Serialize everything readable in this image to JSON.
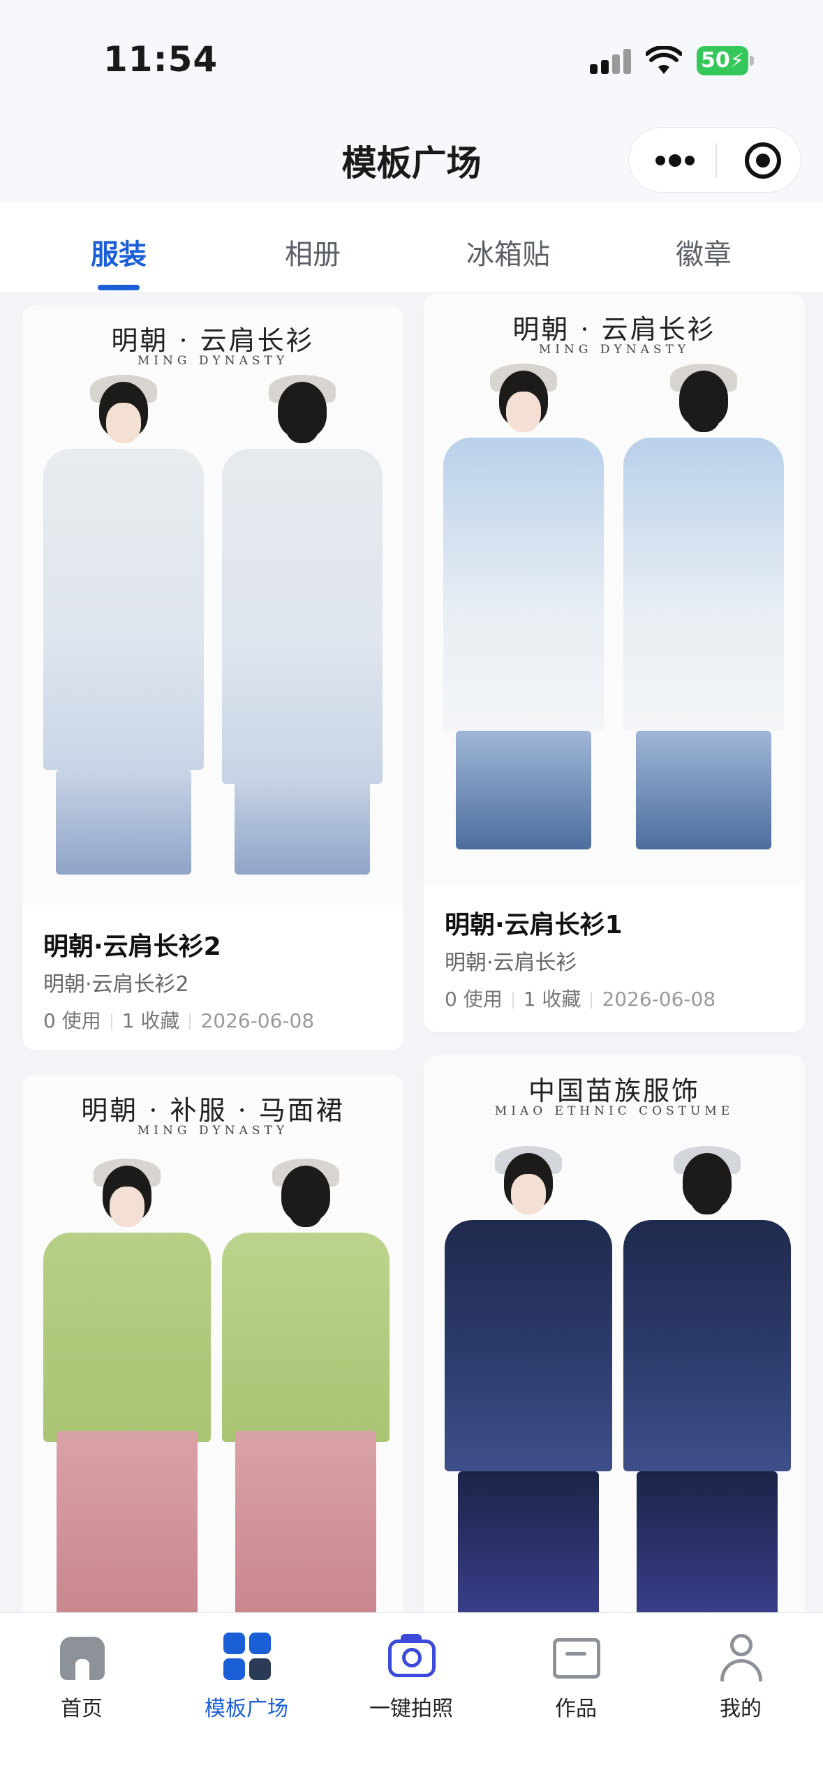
{
  "status_bar": {
    "time": "11:54",
    "battery": "50"
  },
  "nav": {
    "title": "模板广场"
  },
  "tabs": [
    {
      "label": "服装",
      "active": true
    },
    {
      "label": "相册",
      "active": false
    },
    {
      "label": "冰箱贴",
      "active": false
    },
    {
      "label": "徽章",
      "active": false
    }
  ],
  "cards": [
    {
      "poster_title": "明朝 · 云肩长衫",
      "poster_subtitle": "MING DYNASTY",
      "title": "明朝·云肩长衫2",
      "subtitle": "明朝·云肩长衫2",
      "uses": "0 使用",
      "favorites": "1 收藏",
      "date": "2026-06-08"
    },
    {
      "poster_title": "明朝 · 云肩长衫",
      "poster_subtitle": "MING DYNASTY",
      "title": "明朝·云肩长衫1",
      "subtitle": "明朝·云肩长衫",
      "uses": "0 使用",
      "favorites": "1 收藏",
      "date": "2026-06-08"
    },
    {
      "poster_title": "明朝 · 补服 · 马面裙",
      "poster_subtitle": "MING DYNASTY"
    },
    {
      "poster_title": "中国苗族服饰",
      "poster_subtitle": "MIAO ETHNIC COSTUME"
    }
  ],
  "tabbar": [
    {
      "label": "首页",
      "icon": "home-icon"
    },
    {
      "label": "模板广场",
      "icon": "grid-icon",
      "active": true
    },
    {
      "label": "一键拍照",
      "icon": "camera-icon"
    },
    {
      "label": "作品",
      "icon": "folder-icon"
    },
    {
      "label": "我的",
      "icon": "user-icon"
    }
  ],
  "colors": {
    "accent": "#1a5fd6",
    "camera": "#3b4ad8",
    "background": "#f2f4f7"
  }
}
